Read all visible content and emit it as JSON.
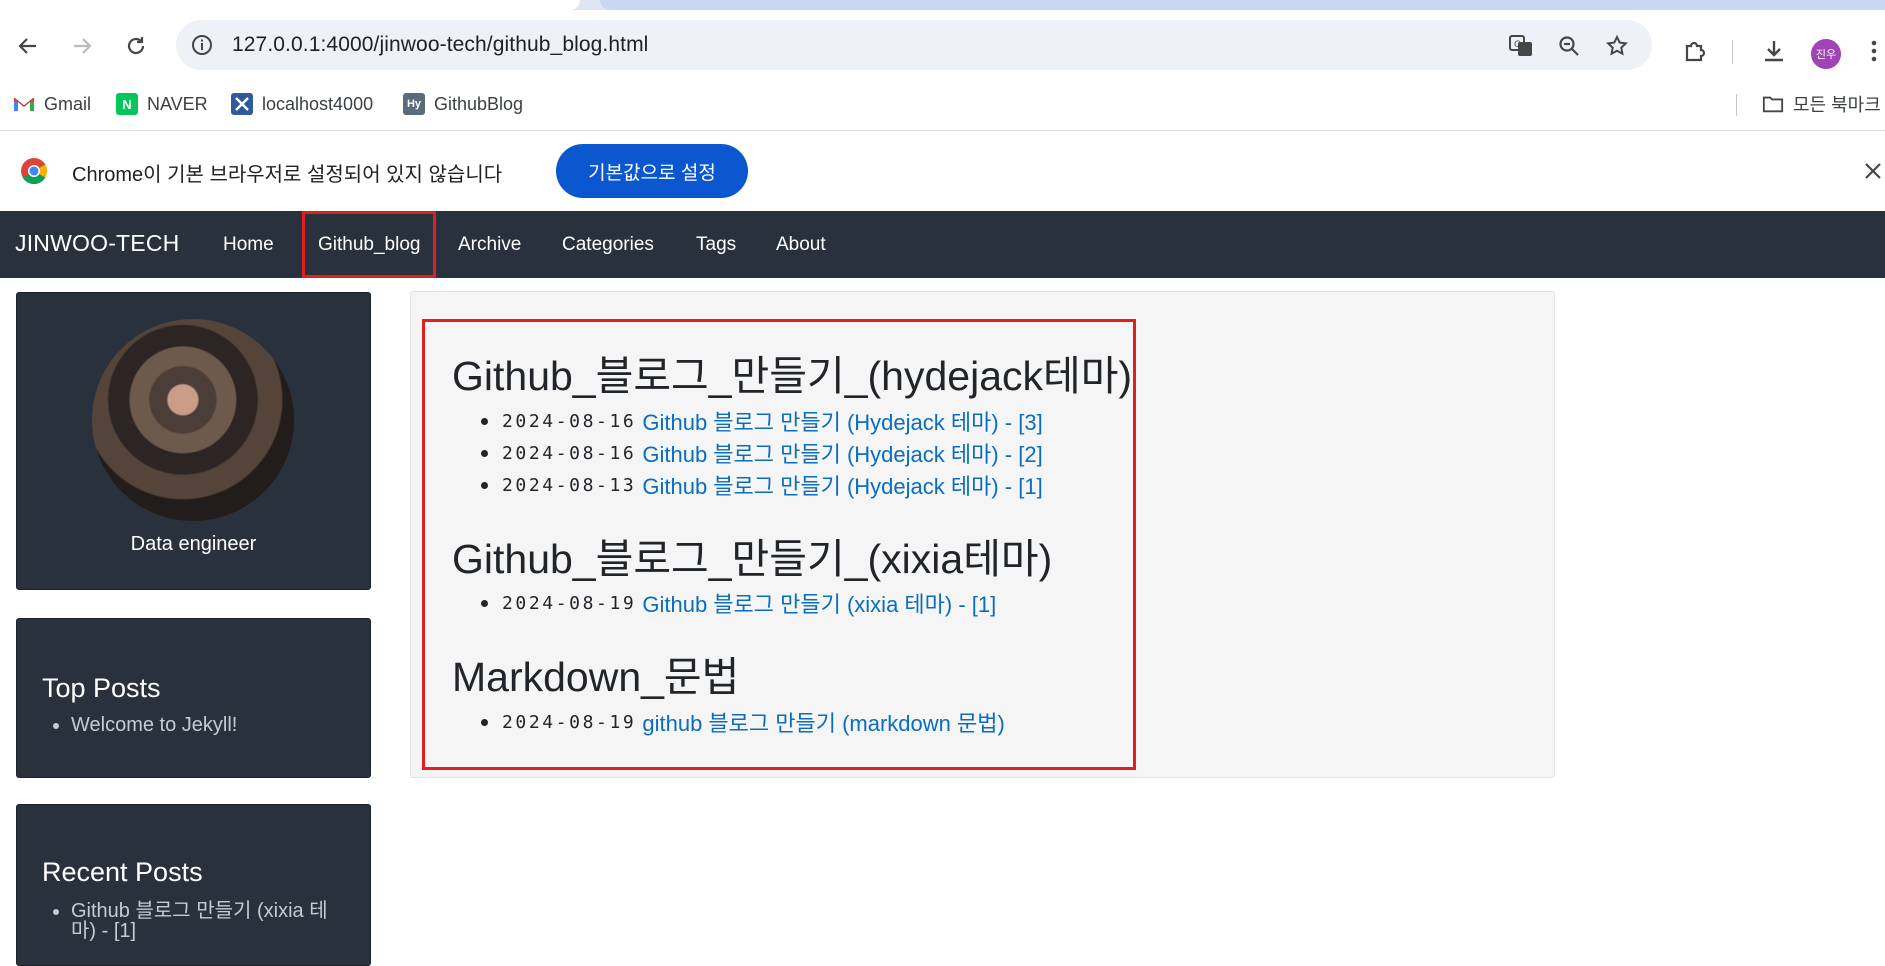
{
  "browser": {
    "url": "127.0.0.1:4000/jinwoo-tech/github_blog.html",
    "profile_initials": "진우",
    "icons": {
      "back": "arrow-left-icon",
      "forward": "arrow-right-icon",
      "reload": "reload-icon",
      "site_info": "info-icon",
      "translate": "translate-icon",
      "zoom": "zoom-icon",
      "bookmark": "star-icon",
      "extensions": "puzzle-icon",
      "downloads": "download-icon",
      "menu": "kebab-menu-icon"
    }
  },
  "bookmarks": {
    "items": [
      {
        "label": "Gmail",
        "icon": "gmail-icon"
      },
      {
        "label": "NAVER",
        "icon": "naver-icon"
      },
      {
        "label": "localhost4000",
        "icon": "x-icon"
      },
      {
        "label": "GithubBlog",
        "icon": "hy-icon"
      }
    ],
    "all_bookmarks_label": "모든 북마크"
  },
  "infobar": {
    "message": "Chrome이 기본 브라우저로 설정되어 있지 않습니다",
    "button_label": "기본값으로 설정"
  },
  "site": {
    "brand": "JINWOO-TECH",
    "nav": [
      {
        "label": "Home"
      },
      {
        "label": "Github_blog"
      },
      {
        "label": "Archive"
      },
      {
        "label": "Categories"
      },
      {
        "label": "Tags"
      },
      {
        "label": "About"
      }
    ]
  },
  "sidebar": {
    "profile_caption": "Data engineer",
    "top_posts": {
      "title": "Top Posts",
      "items": [
        {
          "label": "Welcome to Jekyll!"
        }
      ]
    },
    "recent_posts": {
      "title": "Recent Posts",
      "items": [
        {
          "label": "Github 블로그 만들기 (xixia 테마) - [1]"
        }
      ]
    }
  },
  "main": {
    "sections": [
      {
        "title": "Github_블로그_만들기_(hydejack테마)",
        "posts": [
          {
            "date": "2024-08-16",
            "title": "Github 블로그 만들기 (Hydejack 테마) - [3]"
          },
          {
            "date": "2024-08-16",
            "title": "Github 블로그 만들기 (Hydejack 테마) - [2]"
          },
          {
            "date": "2024-08-13",
            "title": "Github 블로그 만들기 (Hydejack 테마) - [1]"
          }
        ]
      },
      {
        "title": "Github_블로그_만들기_(xixia테마)",
        "posts": [
          {
            "date": "2024-08-19",
            "title": "Github 블로그 만들기 (xixia 테마) - [1]"
          }
        ]
      },
      {
        "title": "Markdown_문법",
        "posts": [
          {
            "date": "2024-08-19",
            "title": "github 블로그 만들기 (markdown 문법)"
          }
        ]
      }
    ]
  },
  "colors": {
    "navbar": "#29323c",
    "link": "#0a6ebd",
    "highlight": "#e02020",
    "primary_button": "#0b57d0"
  }
}
